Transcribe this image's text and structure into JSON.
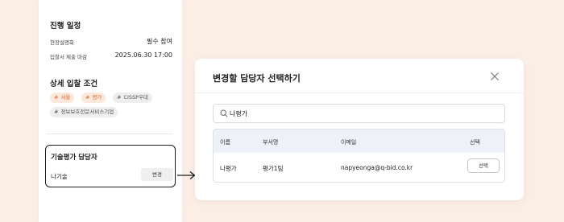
{
  "schedule": {
    "title": "진행 일정",
    "rows": [
      {
        "label": "현장설명회",
        "value": "필수 참여"
      },
      {
        "label": "입찰서 제출 마감",
        "value": "2025.06.30 17:00"
      }
    ]
  },
  "conditions": {
    "title": "상세 입찰 조건",
    "tags": [
      {
        "text": "서울",
        "style": "orange"
      },
      {
        "text": "평가",
        "style": "orange"
      },
      {
        "text": "CISSP우대",
        "style": "gray"
      },
      {
        "text": "정보보호전문서비스기업",
        "style": "gray"
      }
    ],
    "hash_symbol": "#"
  },
  "assessor": {
    "title": "기술평가 담당자",
    "name": "나기술",
    "change_label": "변경"
  },
  "modal": {
    "title": "변경할 담당자 선택하기",
    "search": {
      "value": "나평가",
      "placeholder": ""
    },
    "table": {
      "headers": [
        "이름",
        "부서명",
        "이메일",
        "선택"
      ],
      "rows": [
        {
          "name": "나평가",
          "dept": "평가1팀",
          "email": "napyeonga@q-bid.co.kr",
          "select_label": "선택"
        }
      ]
    }
  },
  "colors": {
    "background": "#fbeee5",
    "accent": "#e0682a",
    "table_header": "#eef2f8"
  }
}
